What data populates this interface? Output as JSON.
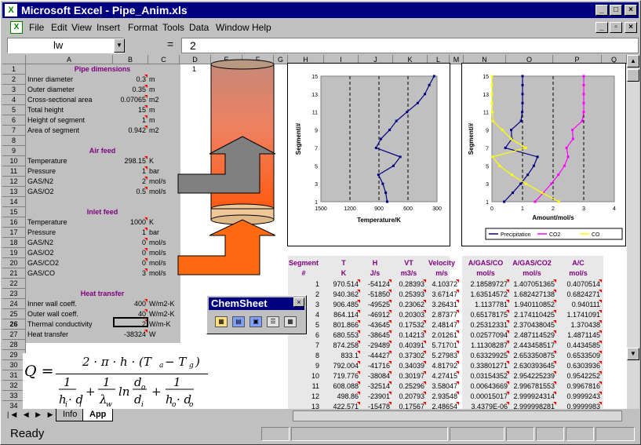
{
  "window": {
    "title": "Microsoft Excel - Pipe_Anim.xls",
    "app_icon": "X"
  },
  "menu": [
    "File",
    "Edit",
    "View",
    "Insert",
    "Format",
    "Tools",
    "Data",
    "Window",
    "Help"
  ],
  "formula": {
    "name_box": "lw",
    "equals": "=",
    "value": "2"
  },
  "columns": [
    "A",
    "B",
    "C",
    "D",
    "E",
    "F",
    "G",
    "H",
    "I",
    "J",
    "K",
    "L",
    "M",
    "N",
    "O",
    "P",
    "Q"
  ],
  "rows": [
    "1",
    "2",
    "3",
    "4",
    "5",
    "6",
    "7",
    "8",
    "9",
    "10",
    "11",
    "12",
    "13",
    "14",
    "15",
    "16",
    "17",
    "18",
    "19",
    "20",
    "21",
    "22",
    "23",
    "24",
    "25",
    "26",
    "27",
    "28",
    "29",
    "30",
    "31",
    "32",
    "33",
    "34"
  ],
  "sections": {
    "pipe": "Pipe dimensions",
    "air": "Air feed",
    "inlet": "Inlet feed",
    "heat": "Heat transfer"
  },
  "params": [
    {
      "label": "Inner diameter",
      "value": "0.3",
      "unit": "m"
    },
    {
      "label": "Outer diameter",
      "value": "0.35",
      "unit": "m"
    },
    {
      "label": "Cross-sectional area",
      "value": "0.07065",
      "unit": "m2"
    },
    {
      "label": "Total height",
      "value": "15",
      "unit": "m"
    },
    {
      "label": "Height of segment",
      "value": "1",
      "unit": "m"
    },
    {
      "label": "Area of segment",
      "value": "0.942",
      "unit": "m2"
    },
    {
      "label": "Temperature",
      "value": "298.15",
      "unit": "K"
    },
    {
      "label": "Pressure",
      "value": "1",
      "unit": "bar"
    },
    {
      "label": "GAS/N2",
      "value": "2",
      "unit": "mol/s"
    },
    {
      "label": "GAS/O2",
      "value": "0.5",
      "unit": "mol/s"
    },
    {
      "label": "Temperature",
      "value": "1000",
      "unit": "K"
    },
    {
      "label": "Pressure",
      "value": "1",
      "unit": "bar"
    },
    {
      "label": "GAS/N2",
      "value": "0",
      "unit": "mol/s"
    },
    {
      "label": "GAS/O2",
      "value": "0",
      "unit": "mol/s"
    },
    {
      "label": "GAS/CO2",
      "value": "0",
      "unit": "mol/s"
    },
    {
      "label": "GAS/CO",
      "value": "3",
      "unit": "mol/s"
    },
    {
      "label": "Inner wall coeff.",
      "value": "400",
      "unit": "W/m2-K"
    },
    {
      "label": "Outer wall coeff.",
      "value": "40",
      "unit": "W/m2-K"
    },
    {
      "label": "Thermal conductivity",
      "value": "2",
      "unit": "W/m-K"
    },
    {
      "label": "Heat transfer",
      "value": "-38324",
      "unit": "W"
    }
  ],
  "d1": "1",
  "table": {
    "headers1": [
      "Segment",
      "T",
      "H",
      "VT",
      "Velocity",
      "A/GAS/CO",
      "A/GAS/CO2",
      "A/C"
    ],
    "headers2": [
      "#",
      "K",
      "J/s",
      "m3/s",
      "m/s",
      "mol/s",
      "mol/s",
      "mol/s"
    ],
    "rows": [
      [
        "1",
        "970.514",
        "-54124",
        "0.28393",
        "4.10372",
        "2.18589727",
        "1.407051365",
        "0.4070514"
      ],
      [
        "2",
        "940.362",
        "-51850",
        "0.25393",
        "3.67147",
        "1.63514572",
        "1.682427138",
        "0.6824271"
      ],
      [
        "3",
        "906.485",
        "-49525",
        "0.23062",
        "3.26431",
        "1.1137781",
        "1.940110852",
        "0.940111"
      ],
      [
        "4",
        "864.114",
        "-46912",
        "0.20303",
        "2.87377",
        "0.65178175",
        "2.174110425",
        "1.1741091"
      ],
      [
        "5",
        "801.866",
        "-43645",
        "0.17532",
        "2.48147",
        "0.25312331",
        "2.370438045",
        "1.370438"
      ],
      [
        "6",
        "680.553",
        "-38645",
        "0.14213",
        "2.01261",
        "0.02577094",
        "2.487114529",
        "1.4871145"
      ],
      [
        "7",
        "874.258",
        "-29489",
        "0.40391",
        "5.71701",
        "1.11308287",
        "2.443458517",
        "0.4434585"
      ],
      [
        "8",
        "833.1",
        "-44427",
        "0.37302",
        "5.27983",
        "0.63329925",
        "2.653350875",
        "0.6533509"
      ],
      [
        "9",
        "792.004",
        "-41716",
        "0.34039",
        "4.81792",
        "0.33801271",
        "2.630393645",
        "0.6303936"
      ],
      [
        "10",
        "719.776",
        "-38084",
        "0.30197",
        "4.27415",
        "0.03154352",
        "2.954225239",
        "0.9542252"
      ],
      [
        "11",
        "608.088",
        "-32514",
        "0.25296",
        "3.58047",
        "0.00643669",
        "2.996781553",
        "0.9967816"
      ],
      [
        "12",
        "498.86",
        "-23901",
        "0.20793",
        "2.93548",
        "0.00015017",
        "2.999924314",
        "0.9999243"
      ],
      [
        "13",
        "422.571",
        "-15478",
        "0.17567",
        "2.48654",
        "3.4379E-06",
        "2.999998281",
        "0.9999983"
      ]
    ]
  },
  "tabs": [
    "Info",
    "App"
  ],
  "status": "Ready",
  "palette": {
    "title": "ChemSheet",
    "close": "×"
  },
  "equation": {
    "lhs": "Q =",
    "num": "2 · π · h · (T",
    "sub_a": "a",
    "minus": "− T",
    "sub_g": "g",
    "rparen": ")"
  },
  "chart_data": [
    {
      "type": "line",
      "xlabel": "Temperature/K",
      "ylabel": "Segment/#",
      "xlim": [
        1500,
        300
      ],
      "ylim": [
        1,
        15
      ],
      "x_ticks": [
        "1500",
        "1200",
        "900",
        "600",
        "300"
      ],
      "y_ticks": [
        "1",
        "3",
        "5",
        "7",
        "9",
        "11",
        "13",
        "15"
      ],
      "grid": "vertical dashed",
      "series": [
        {
          "points": [
            [
              815,
              1
            ],
            [
              830,
              2
            ],
            [
              860,
              3
            ],
            [
              905,
              4
            ],
            [
              750,
              5
            ],
            [
              680,
              6
            ],
            [
              930,
              7
            ],
            [
              880,
              8
            ],
            [
              790,
              9
            ],
            [
              720,
              10
            ],
            [
              610,
              11
            ],
            [
              500,
              12
            ],
            [
              425,
              13
            ],
            [
              380,
              14
            ],
            [
              330,
              15
            ]
          ]
        }
      ]
    },
    {
      "type": "line",
      "xlabel": "Amount/mol/s",
      "ylabel": "Segment/#",
      "xlim": [
        0,
        4
      ],
      "ylim": [
        1,
        15
      ],
      "x_ticks": [
        "0",
        "1",
        "2",
        "3",
        "4"
      ],
      "y_ticks": [
        "1",
        "3",
        "5",
        "7",
        "9",
        "11",
        "13",
        "15"
      ],
      "legend": [
        "Precipitation",
        "CO2",
        "CO"
      ],
      "legend_position": "bottom",
      "series": [
        {
          "name": "Precipitation",
          "color": "#000080",
          "points": [
            [
              0.4,
              1
            ],
            [
              0.68,
              2
            ],
            [
              0.94,
              3
            ],
            [
              1.17,
              4
            ],
            [
              1.37,
              5
            ],
            [
              1.49,
              6
            ],
            [
              0.44,
              7
            ],
            [
              0.65,
              8
            ],
            [
              0.63,
              9
            ],
            [
              0.95,
              10
            ],
            [
              0.99,
              11
            ],
            [
              1.0,
              12
            ],
            [
              1.0,
              13
            ],
            [
              1.0,
              14
            ],
            [
              1.0,
              15
            ]
          ]
        },
        {
          "name": "CO2",
          "color": "#ff00ff",
          "points": [
            [
              1.41,
              1
            ],
            [
              1.68,
              2
            ],
            [
              1.94,
              3
            ],
            [
              2.17,
              4
            ],
            [
              2.37,
              5
            ],
            [
              2.49,
              6
            ],
            [
              2.44,
              7
            ],
            [
              2.65,
              8
            ],
            [
              2.63,
              9
            ],
            [
              2.95,
              10
            ],
            [
              3.0,
              11
            ],
            [
              3.0,
              12
            ],
            [
              3.0,
              13
            ],
            [
              3.0,
              14
            ],
            [
              3.0,
              15
            ]
          ]
        },
        {
          "name": "CO",
          "color": "#ffff00",
          "points": [
            [
              2.19,
              1
            ],
            [
              1.64,
              2
            ],
            [
              1.11,
              3
            ],
            [
              0.65,
              4
            ],
            [
              0.25,
              5
            ],
            [
              0.03,
              6
            ],
            [
              1.11,
              7
            ],
            [
              0.63,
              8
            ],
            [
              0.34,
              9
            ],
            [
              0.03,
              10
            ],
            [
              0.01,
              11
            ],
            [
              0.0,
              12
            ],
            [
              0.0,
              13
            ],
            [
              0.0,
              14
            ],
            [
              0.0,
              15
            ]
          ]
        }
      ]
    }
  ]
}
